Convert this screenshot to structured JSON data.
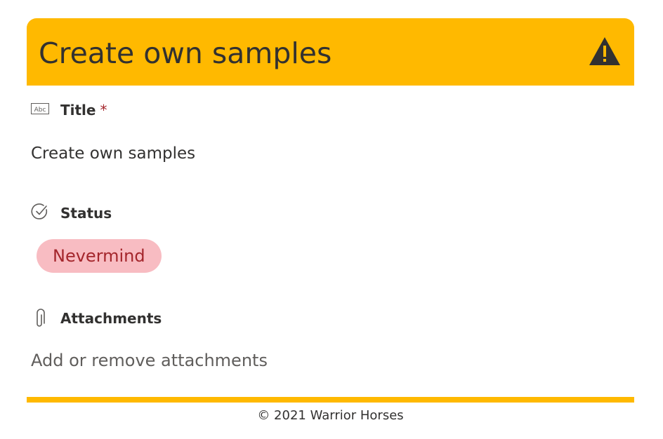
{
  "header": {
    "title": "Create own samples",
    "icon": "warning-icon",
    "background_color": "#ffb900"
  },
  "fields": {
    "title": {
      "label": "Title",
      "required_marker": "*",
      "value": "Create own samples",
      "icon": "text-field-icon"
    },
    "status": {
      "label": "Status",
      "value": "Nevermind",
      "icon": "status-check-icon",
      "pill_color": "#f8bcc2",
      "text_color": "#a4262c"
    },
    "attachments": {
      "label": "Attachments",
      "action": "Add or remove attachments",
      "icon": "paperclip-icon"
    }
  },
  "footer": {
    "text": "© 2021 Warrior Horses",
    "bar_color": "#ffb900"
  }
}
